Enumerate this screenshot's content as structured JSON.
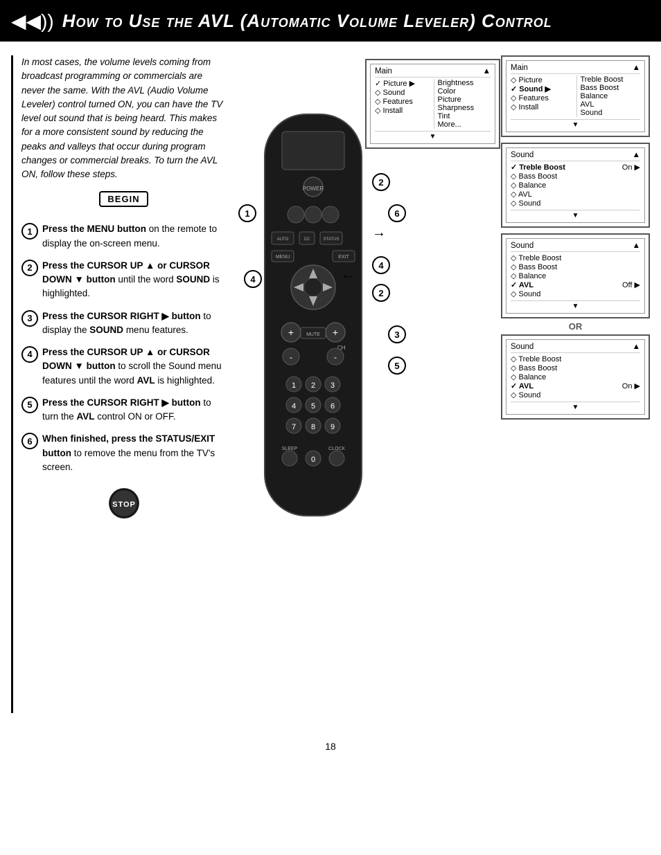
{
  "header": {
    "icon": "◀◀))",
    "title": "How to Use the AVL (Automatic Volume Leveler) Control"
  },
  "intro": "In most cases, the volume levels coming from broadcast programming or commercials are never the same.  With the AVL (Audio Volume Leveler) control turned ON, you can have the TV level out sound that is being heard.  This makes for a more consistent sound by reducing the peaks and valleys that occur during program changes or commercial breaks.  To turn the AVL ON, follow these steps.",
  "begin_label": "BEGIN",
  "steps": [
    {
      "num": "1",
      "text": "Press the MENU button on the remote to display the on-screen menu."
    },
    {
      "num": "2",
      "text": "Press the CURSOR UP ▲ or CURSOR DOWN ▼ button until the word SOUND is highlighted."
    },
    {
      "num": "3",
      "text": "Press the CURSOR RIGHT ▶ button to display the SOUND menu features."
    },
    {
      "num": "4",
      "text": "Press the CURSOR UP ▲ or CURSOR DOWN ▼ button to scroll the Sound menu features until the word AVL is highlighted."
    },
    {
      "num": "5",
      "text": "Press the CURSOR RIGHT ▶ button to turn the AVL control ON or OFF."
    },
    {
      "num": "6",
      "text": "When finished, press the STATUS/EXIT button to remove the menu from the TV's screen."
    }
  ],
  "stop_label": "STOP",
  "menus": {
    "menu1": {
      "header": "Main",
      "items": [
        {
          "icon": "✓",
          "label": "Picture",
          "sub": "Brightness"
        },
        {
          "icon": "◇",
          "label": "Sound",
          "sub": "Color"
        },
        {
          "icon": "◇",
          "label": "Features",
          "sub": "Picture"
        },
        {
          "icon": "◇",
          "label": "Install",
          "sub": "Sharpness"
        },
        {
          "label": "",
          "sub": "Tint"
        },
        {
          "label": "",
          "sub": "More..."
        }
      ]
    },
    "menu2": {
      "header": "Main",
      "items": [
        {
          "icon": "◇",
          "label": "Picture",
          "right": "Treble Boost"
        },
        {
          "icon": "✓",
          "label": "Sound",
          "arrow": "▶",
          "right": "Bass Boost"
        },
        {
          "icon": "◇",
          "label": "Features",
          "right": "Balance"
        },
        {
          "icon": "◇",
          "label": "Install",
          "right": "AVL"
        },
        {
          "label": "",
          "right": "Sound"
        }
      ]
    },
    "menu3": {
      "header": "Sound",
      "items": [
        {
          "icon": "✓",
          "label": "Treble Boost",
          "right": "On",
          "arrow": "▶"
        },
        {
          "icon": "◇",
          "label": "Bass Boost"
        },
        {
          "icon": "◇",
          "label": "Balance"
        },
        {
          "icon": "◇",
          "label": "AVL"
        },
        {
          "icon": "◇",
          "label": "Sound"
        }
      ]
    },
    "menu4": {
      "header": "Sound",
      "items": [
        {
          "icon": "◇",
          "label": "Treble Boost"
        },
        {
          "icon": "◇",
          "label": "Bass Boost"
        },
        {
          "icon": "◇",
          "label": "Balance"
        },
        {
          "icon": "✓",
          "label": "AVL",
          "right": "Off",
          "arrow": "▶"
        },
        {
          "icon": "◇",
          "label": "Sound"
        }
      ]
    },
    "or_label": "OR",
    "menu5": {
      "header": "Sound",
      "items": [
        {
          "icon": "◇",
          "label": "Treble Boost"
        },
        {
          "icon": "◇",
          "label": "Bass Boost"
        },
        {
          "icon": "◇",
          "label": "Balance"
        },
        {
          "icon": "✓",
          "label": "AVL",
          "right": "On",
          "arrow": "▶"
        },
        {
          "icon": "◇",
          "label": "Sound"
        }
      ]
    }
  },
  "page_number": "18",
  "step_bubbles": [
    "1",
    "2",
    "3",
    "4",
    "5",
    "6"
  ]
}
